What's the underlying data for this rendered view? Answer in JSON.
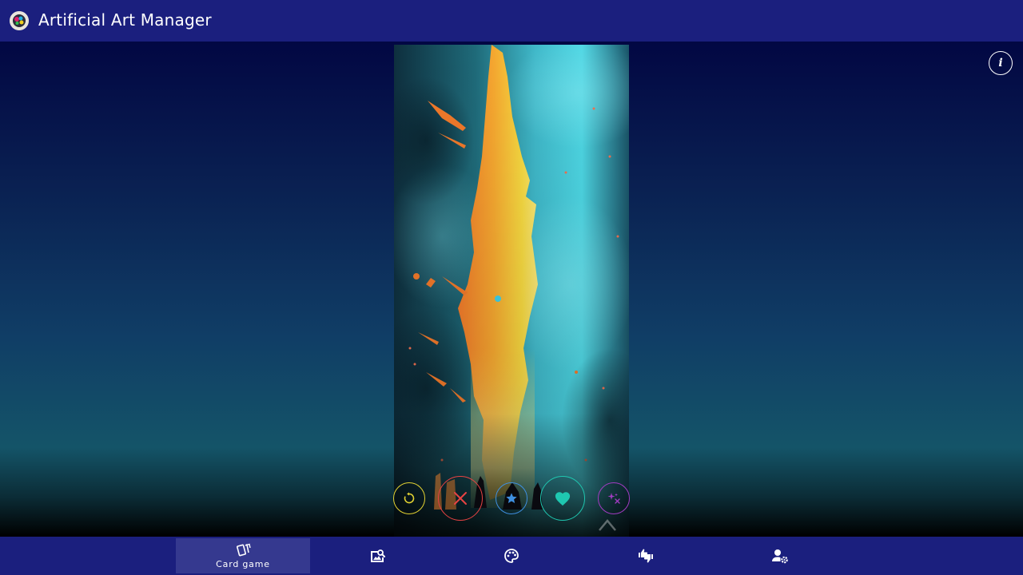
{
  "app": {
    "title": "Artificial Art Manager",
    "logo_icon": "painting-palette-logo"
  },
  "info": {
    "label": "i",
    "icon": "info-icon"
  },
  "card": {
    "image_description_icon": "artwork-image"
  },
  "actions": [
    {
      "name": "rewind",
      "icon": "rewind-icon",
      "color": "#e3d232"
    },
    {
      "name": "nope",
      "icon": "close-icon",
      "color": "#e84343"
    },
    {
      "name": "super-like",
      "icon": "star-icon",
      "color": "#3e8fe0"
    },
    {
      "name": "like",
      "icon": "heart-icon",
      "color": "#1fc7b0"
    },
    {
      "name": "boost",
      "icon": "sparkles-icon",
      "color": "#a23cc2"
    }
  ],
  "nav": {
    "items": [
      {
        "label": "Card game",
        "icon": "cards-icon",
        "active": true
      },
      {
        "label": "",
        "icon": "image-search-icon",
        "active": false
      },
      {
        "label": "",
        "icon": "palette-icon",
        "active": false
      },
      {
        "label": "",
        "icon": "thumbs-up-down-icon",
        "active": false
      },
      {
        "label": "",
        "icon": "user-settings-icon",
        "active": false
      }
    ]
  },
  "colors": {
    "bar": "#1b1f7e",
    "active_tab": "#35398f",
    "rewind": "#e3d232",
    "nope": "#e84343",
    "super_like": "#3e8fe0",
    "like": "#1fc7b0",
    "boost": "#a23cc2"
  }
}
